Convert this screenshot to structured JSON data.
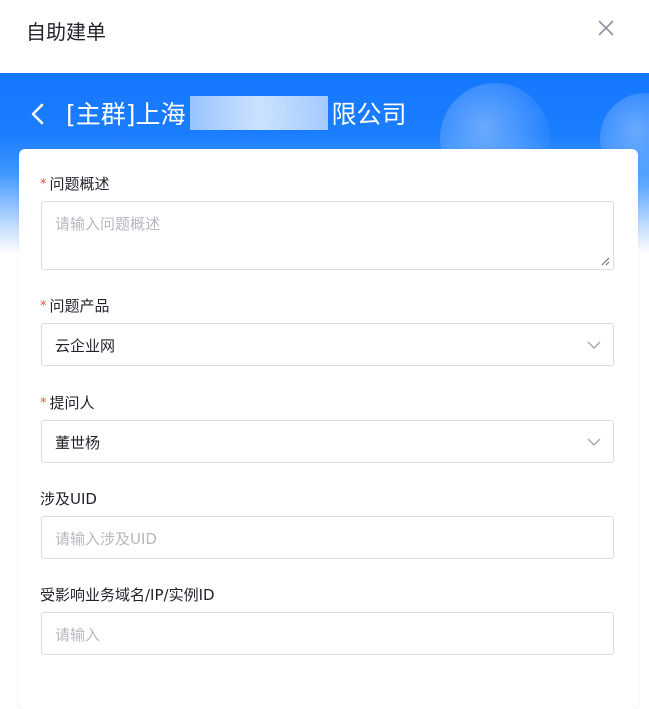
{
  "dialog": {
    "title": "自助建单"
  },
  "banner": {
    "group_prefix": "[主群]上海",
    "group_suffix": "限公司"
  },
  "form": {
    "required_mark": "*",
    "fields": [
      {
        "label": "问题概述",
        "required": true,
        "type": "textarea",
        "placeholder": "请输入问题概述",
        "value": ""
      },
      {
        "label": "问题产品",
        "required": true,
        "type": "select",
        "value": "云企业网"
      },
      {
        "label": "提问人",
        "required": true,
        "type": "select",
        "value": "董世杨"
      },
      {
        "label": "涉及UID",
        "required": false,
        "type": "input",
        "placeholder": "请输入涉及UID",
        "value": ""
      },
      {
        "label": "受影响业务域名/IP/实例ID",
        "required": false,
        "type": "input",
        "placeholder": "请输入",
        "value": ""
      }
    ]
  },
  "colors": {
    "primary": "#1677ff",
    "required": "#f54a45",
    "border": "#d9dce1",
    "placeholder": "#b4b8bf"
  },
  "icons": {
    "close": "close-icon",
    "back": "chevron-left-icon",
    "dropdown": "chevron-down-icon",
    "resize": "resize-handle-icon"
  }
}
